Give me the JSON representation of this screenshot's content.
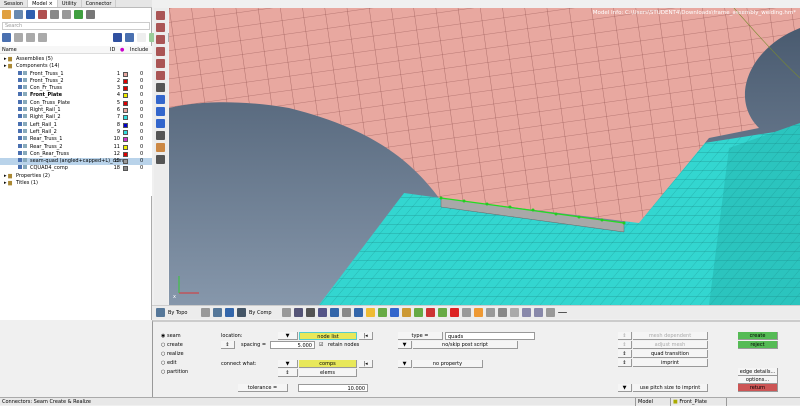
{
  "tabs": [
    "Session",
    "Model ×",
    "Utility",
    "Connector"
  ],
  "search_placeholder": "Search",
  "tree": {
    "headers": {
      "name": "Name",
      "id": "ID",
      "include": "Include"
    },
    "rows": [
      {
        "label": "Assemblies (5)",
        "level": 0
      },
      {
        "label": "Components (14)",
        "level": 0
      },
      {
        "label": "Front_Truss_1",
        "id": "1",
        "color": "#e8a8a0",
        "inc": "0",
        "level": 1
      },
      {
        "label": "Front_Truss_2",
        "id": "2",
        "color": "#dd0000",
        "inc": "0",
        "level": 1
      },
      {
        "label": "Con_Fr_Truss",
        "id": "3",
        "color": "#dd0000",
        "inc": "0",
        "level": 1
      },
      {
        "label": "Front_Plate",
        "id": "4",
        "color": "#eeee00",
        "inc": "0",
        "level": 1,
        "bold": true
      },
      {
        "label": "Con_Truss_Plate",
        "id": "5",
        "color": "#dd0000",
        "inc": "0",
        "level": 1
      },
      {
        "label": "Right_Rail_1",
        "id": "6",
        "color": "#e8a8a0",
        "inc": "0",
        "level": 1
      },
      {
        "label": "Right_Rail_2",
        "id": "7",
        "color": "#33dddd",
        "inc": "0",
        "level": 1
      },
      {
        "label": "Left_Rail_1",
        "id": "8",
        "color": "#0000cc",
        "inc": "0",
        "level": 1
      },
      {
        "label": "Left_Rail_2",
        "id": "9",
        "color": "#33dddd",
        "inc": "0",
        "level": 1
      },
      {
        "label": "Rear_Truss_1",
        "id": "10",
        "color": "#cc33cc",
        "inc": "0",
        "level": 1
      },
      {
        "label": "Rear_Truss_2",
        "id": "11",
        "color": "#eeee00",
        "inc": "0",
        "level": 1
      },
      {
        "label": "Con_Rear_Truss",
        "id": "12",
        "color": "#dd0000",
        "inc": "0",
        "level": 1
      },
      {
        "label": "seam-quad (angled+capped+L)_comp",
        "id": "15",
        "color": "#999999",
        "inc": "0",
        "level": 1,
        "selected": true
      },
      {
        "label": "CQUAD4_comp",
        "id": "18",
        "color": "#888888",
        "inc": "0",
        "level": 1
      },
      {
        "label": "Properties (2)",
        "level": 0
      },
      {
        "label": "Titles (1)",
        "level": 0
      }
    ]
  },
  "viewport": {
    "model_info": "Model Info: C:\\Users\\STUDENT4\\Downloads\\frame_assembly_welding.hm*",
    "colors": {
      "salmon": "#e8a8a0",
      "cyan": "#33d6d0",
      "bg_top": "#4a5a6e",
      "bg_bottom": "#7d8ea3"
    }
  },
  "toolbar": {
    "by_topo": "By Topo",
    "by_comp": "By Comp"
  },
  "panel": {
    "modes": [
      "seam",
      "create",
      "realize",
      "edit",
      "partition"
    ],
    "selected_mode": "seam",
    "location_label": "location:",
    "node_list": "node list",
    "spacing_label": "spacing =",
    "spacing_value": "5.000",
    "retain_nodes": "retain nodes",
    "connect_what": "connect what:",
    "comps": "comps",
    "elems": "elems",
    "tolerance_label": "tolerance =",
    "tolerance_value": "10.000",
    "type_label": "type =",
    "type_value": "quads",
    "post_script": "no/skip post script",
    "no_property": "no property",
    "mesh_dependent": "mesh dependent",
    "adjust_mesh": "adjust mesh",
    "quad_transition": "quad transition",
    "imprint": "imprint",
    "pitch": "use pitch size to imprint",
    "create": "create",
    "reject": "reject",
    "edge_details": "edge details...",
    "options": "options...",
    "return": "return"
  },
  "status": {
    "message": "Connectors: Seam Create & Realize",
    "model": "Model",
    "component": "Front_Plate"
  }
}
